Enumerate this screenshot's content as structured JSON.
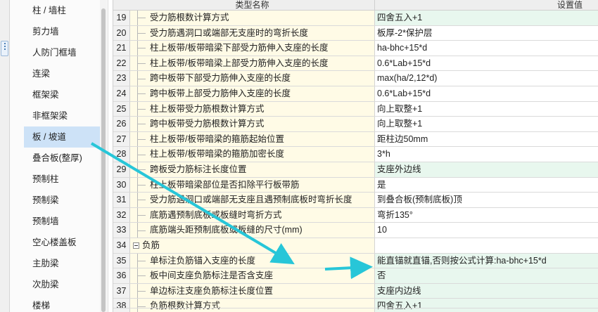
{
  "sidebar": {
    "items": [
      {
        "label": "柱 / 墙柱",
        "selected": false
      },
      {
        "label": "剪力墙",
        "selected": false
      },
      {
        "label": "人防门框墙",
        "selected": false
      },
      {
        "label": "连梁",
        "selected": false
      },
      {
        "label": "框架梁",
        "selected": false
      },
      {
        "label": "非框架梁",
        "selected": false
      },
      {
        "label": "板 / 坡道",
        "selected": true
      },
      {
        "label": "叠合板(整厚)",
        "selected": false
      },
      {
        "label": "预制柱",
        "selected": false
      },
      {
        "label": "预制梁",
        "selected": false
      },
      {
        "label": "预制墙",
        "selected": false
      },
      {
        "label": "空心楼盖板",
        "selected": false
      },
      {
        "label": "主肋梁",
        "selected": false
      },
      {
        "label": "次肋梁",
        "selected": false
      },
      {
        "label": "楼梯",
        "selected": false
      }
    ]
  },
  "table": {
    "headers": {
      "name": "类型名称",
      "value": "设置值"
    },
    "rows": [
      {
        "num": "19",
        "name": "受力筋根数计算方式",
        "value": "四舍五入+1",
        "highlight": "green"
      },
      {
        "num": "20",
        "name": "受力筋遇洞口或端部无支座时的弯折长度",
        "value": "板厚-2*保护层",
        "highlight": "white"
      },
      {
        "num": "21",
        "name": "柱上板带/板带暗梁下部受力筋伸入支座的长度",
        "value": "ha-bhc+15*d",
        "highlight": "white"
      },
      {
        "num": "22",
        "name": "柱上板带/板带暗梁上部受力筋伸入支座的长度",
        "value": "0.6*Lab+15*d",
        "highlight": "white"
      },
      {
        "num": "23",
        "name": "跨中板带下部受力筋伸入支座的长度",
        "value": "max(ha/2,12*d)",
        "highlight": "white"
      },
      {
        "num": "24",
        "name": "跨中板带上部受力筋伸入支座的长度",
        "value": "0.6*Lab+15*d",
        "highlight": "white"
      },
      {
        "num": "25",
        "name": "柱上板带受力筋根数计算方式",
        "value": "向上取整+1",
        "highlight": "white"
      },
      {
        "num": "26",
        "name": "跨中板带受力筋根数计算方式",
        "value": "向上取整+1",
        "highlight": "white"
      },
      {
        "num": "27",
        "name": "柱上板带/板带暗梁的箍筋起始位置",
        "value": "距柱边50mm",
        "highlight": "white"
      },
      {
        "num": "28",
        "name": "柱上板带/板带暗梁的箍筋加密长度",
        "value": "3*h",
        "highlight": "white"
      },
      {
        "num": "29",
        "name": "跨板受力筋标注长度位置",
        "value": "支座外边线",
        "highlight": "green"
      },
      {
        "num": "30",
        "name": "柱上板带暗梁部位是否扣除平行板带筋",
        "value": "是",
        "highlight": "white"
      },
      {
        "num": "31",
        "name": "受力筋遇洞口或端部无支座且遇预制底板时弯折长度",
        "value": "到叠合板(预制底板)顶",
        "highlight": "white"
      },
      {
        "num": "32",
        "name": "底筋遇预制底板或板缝时弯折方式",
        "value": "弯折135°",
        "highlight": "white"
      },
      {
        "num": "33",
        "name": "底筋端头距预制底板或板缝的尺寸(mm)",
        "value": "10",
        "highlight": "white"
      },
      {
        "num": "34",
        "name": "负筋",
        "value": "",
        "highlight": "group"
      },
      {
        "num": "35",
        "name": "单标注负筋锚入支座的长度",
        "value": "能直锚就直锚,否则按公式计算:ha-bhc+15*d",
        "highlight": "green"
      },
      {
        "num": "36",
        "name": "板中间支座负筋标注是否含支座",
        "value": "否",
        "highlight": "green"
      },
      {
        "num": "37",
        "name": "单边标注支座负筋标注长度位置",
        "value": "支座内边线",
        "highlight": "green"
      },
      {
        "num": "38",
        "name": "负筋根数计算方式",
        "value": "四舍五入+1",
        "highlight": "green"
      }
    ]
  },
  "annotation": {
    "color": "#27c6d8"
  },
  "icons": {
    "toggle": "collapse-toggle-icon",
    "grip": "panel-grip-icon"
  }
}
